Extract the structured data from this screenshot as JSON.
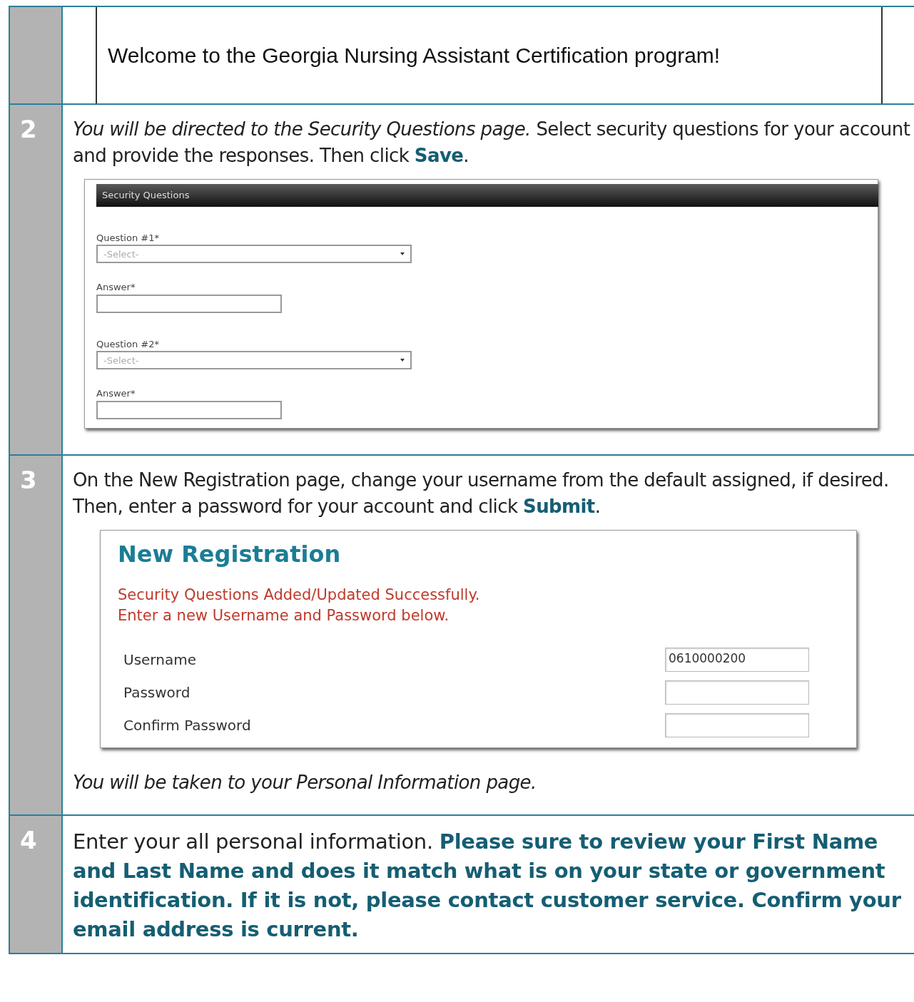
{
  "steps": [
    {
      "blocks": [
        {
          "kind": "banner",
          "text": "Welcome to the Georgia Nursing Assistant Certification program!"
        }
      ]
    },
    {
      "number": "2",
      "blocks": [
        {
          "kind": "paragraph",
          "text": "*You will be directed to the Security Questions page.* Select security questions for your account and provide the responses. Then click **Save**."
        },
        {
          "kind": "security_questions",
          "title": "Security Questions",
          "groups": [
            {
              "question_label": "Question #1*",
              "select_placeholder": "-Select-",
              "answer_label": "Answer*"
            },
            {
              "question_label": "Question #2*",
              "select_placeholder": "-Select-",
              "answer_label": "Answer*"
            }
          ]
        }
      ]
    },
    {
      "number": "3",
      "blocks": [
        {
          "kind": "paragraph",
          "text": "On the New Registration page, change your username from the default assigned, if desired. Then, enter a password for your account and click **Submit**."
        },
        {
          "kind": "registration",
          "title": "New Registration",
          "messages": [
            "Security Questions Added/Updated Successfully.",
            "Enter a new Username and Password below."
          ],
          "fields": [
            {
              "label": "Username",
              "value": "0610000200"
            },
            {
              "label": "Password"
            },
            {
              "label": "Confirm Password"
            }
          ]
        },
        {
          "kind": "paragraph",
          "text": "*You will be taken to your Personal Information page.*"
        }
      ]
    },
    {
      "number": "4",
      "blocks": [
        {
          "kind": "big_paragraph",
          "text": "Enter your all personal information. **Please sure to review your First Name and Last Name and does it match what is on your state or government identification.  If it is not, please contact customer service.  Confirm your email address is current.**"
        }
      ]
    }
  ]
}
